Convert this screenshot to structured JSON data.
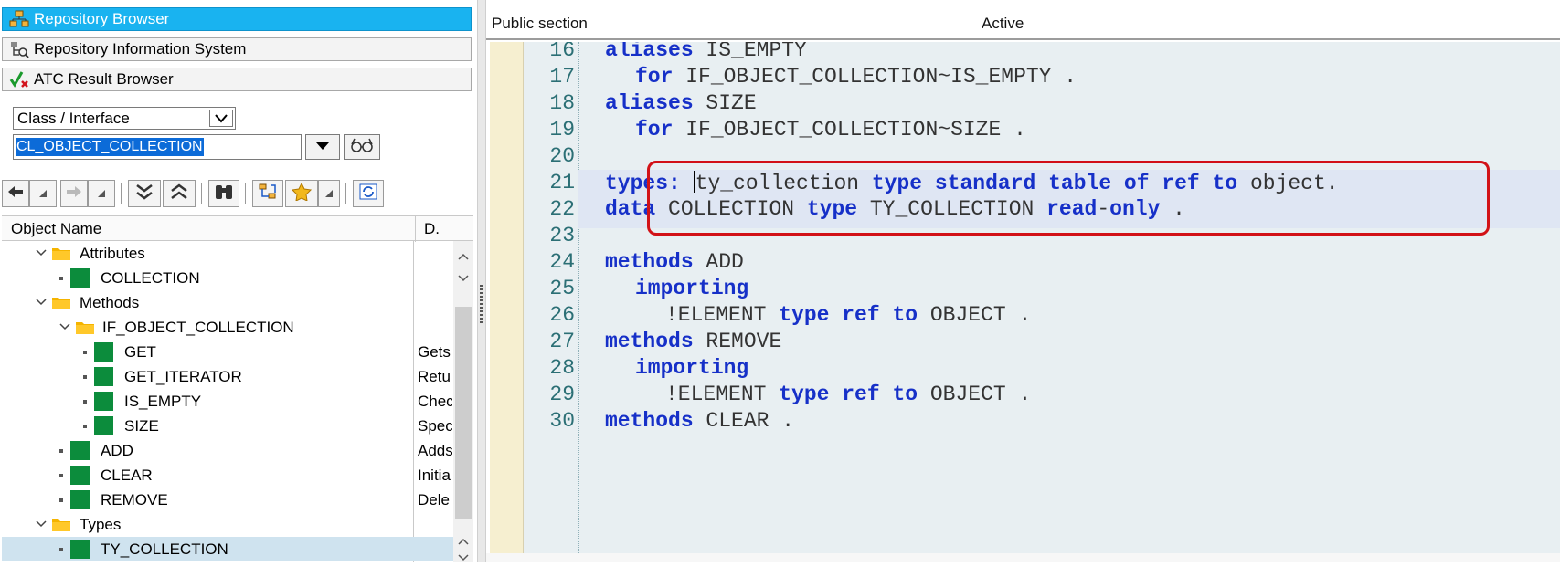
{
  "left_nav": {
    "buttons": [
      {
        "label": "Repository Browser",
        "icon": "repository-browser-icon",
        "active": true
      },
      {
        "label": "Repository Information System",
        "icon": "info-system-icon",
        "active": false
      },
      {
        "label": "ATC Result Browser",
        "icon": "atc-check-icon",
        "active": false
      }
    ],
    "object_type": "Class / Interface",
    "object_name": "CL_OBJECT_COLLECTION",
    "accent_color": "#19b3f0"
  },
  "toolbar": {
    "icons": [
      "back-arrow-icon",
      "forward-arrow-icon",
      "expand-all-icon",
      "collapse-all-icon",
      "binoculars-icon",
      "hierarchy-icon",
      "favorite-star-icon",
      "refresh-icon"
    ]
  },
  "tree": {
    "columns": [
      "Object Name",
      "D."
    ],
    "rows": [
      {
        "label": "Attributes",
        "kind": "folder",
        "level": 1,
        "desc": ""
      },
      {
        "label": "COLLECTION",
        "kind": "item",
        "level": 1,
        "desc": ""
      },
      {
        "label": "Methods",
        "kind": "folder",
        "level": 1,
        "desc": ""
      },
      {
        "label": "IF_OBJECT_COLLECTION",
        "kind": "folder",
        "level": 2,
        "desc": ""
      },
      {
        "label": "GET",
        "kind": "item",
        "level": 2,
        "desc": "Gets"
      },
      {
        "label": "GET_ITERATOR",
        "kind": "item",
        "level": 2,
        "desc": "Retu"
      },
      {
        "label": "IS_EMPTY",
        "kind": "item",
        "level": 2,
        "desc": "Chec"
      },
      {
        "label": "SIZE",
        "kind": "item",
        "level": 2,
        "desc": "Spec"
      },
      {
        "label": "ADD",
        "kind": "item",
        "level": 1,
        "desc": "Adds"
      },
      {
        "label": "CLEAR",
        "kind": "item",
        "level": 1,
        "desc": "Initia"
      },
      {
        "label": "REMOVE",
        "kind": "item",
        "level": 1,
        "desc": "Dele"
      },
      {
        "label": "Types",
        "kind": "folder",
        "level": 1,
        "desc": ""
      },
      {
        "label": "TY_COLLECTION",
        "kind": "item",
        "level": 1,
        "desc": "",
        "selected": true
      }
    ]
  },
  "editor": {
    "section": "Public section",
    "status": "Active",
    "highlight_color": "#d21217",
    "lines": [
      {
        "n": "16",
        "tokens": [
          [
            "kw",
            "aliases"
          ],
          [
            "t",
            " IS_EMPTY"
          ]
        ],
        "indent": 0
      },
      {
        "n": "17",
        "tokens": [
          [
            "kw",
            "for"
          ],
          [
            "t",
            " IF_OBJECT_COLLECTION~IS_EMPTY ."
          ]
        ],
        "indent": 1
      },
      {
        "n": "18",
        "tokens": [
          [
            "kw",
            "aliases"
          ],
          [
            "t",
            " SIZE"
          ]
        ],
        "indent": 0
      },
      {
        "n": "19",
        "tokens": [
          [
            "kw",
            "for"
          ],
          [
            "t",
            " IF_OBJECT_COLLECTION~SIZE ."
          ]
        ],
        "indent": 1
      },
      {
        "n": "20",
        "tokens": [],
        "indent": 0
      },
      {
        "n": "21",
        "tokens": [
          [
            "kw",
            "types:"
          ],
          [
            "t",
            " "
          ],
          [
            "caret",
            ""
          ],
          [
            "t",
            "ty_collection "
          ],
          [
            "kw",
            "type standard table of ref to"
          ],
          [
            "t",
            " object."
          ]
        ],
        "indent": 0
      },
      {
        "n": "22",
        "tokens": [
          [
            "kw",
            "data"
          ],
          [
            "t",
            " COLLECTION "
          ],
          [
            "kw",
            "type"
          ],
          [
            "t",
            " TY_COLLECTION "
          ],
          [
            "kw",
            "read"
          ],
          [
            "t",
            "-"
          ],
          [
            "kw",
            "only"
          ],
          [
            "t",
            " ."
          ]
        ],
        "indent": 0
      },
      {
        "n": "23",
        "tokens": [],
        "indent": 0
      },
      {
        "n": "24",
        "tokens": [
          [
            "kw",
            "methods"
          ],
          [
            "t",
            " ADD"
          ]
        ],
        "indent": 0
      },
      {
        "n": "25",
        "tokens": [
          [
            "kw",
            "importing"
          ]
        ],
        "indent": 1
      },
      {
        "n": "26",
        "tokens": [
          [
            "t",
            "!ELEMENT "
          ],
          [
            "kw",
            "type ref to"
          ],
          [
            "t",
            " OBJECT ."
          ]
        ],
        "indent": 2
      },
      {
        "n": "27",
        "tokens": [
          [
            "kw",
            "methods"
          ],
          [
            "t",
            " REMOVE"
          ]
        ],
        "indent": 0
      },
      {
        "n": "28",
        "tokens": [
          [
            "kw",
            "importing"
          ]
        ],
        "indent": 1
      },
      {
        "n": "29",
        "tokens": [
          [
            "t",
            "!ELEMENT "
          ],
          [
            "kw",
            "type ref to"
          ],
          [
            "t",
            " OBJECT ."
          ]
        ],
        "indent": 2
      },
      {
        "n": "30",
        "tokens": [
          [
            "kw",
            "methods"
          ],
          [
            "t",
            " CLEAR ."
          ]
        ],
        "indent": 0
      }
    ]
  }
}
